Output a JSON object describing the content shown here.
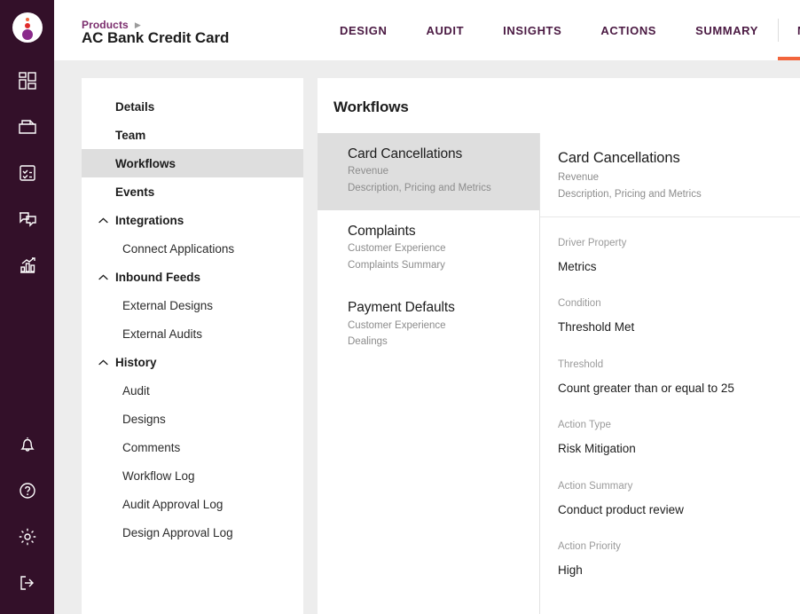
{
  "rail": {
    "avatar_name": "user-avatar",
    "icons": [
      {
        "name": "dashboard-icon"
      },
      {
        "name": "folder-icon"
      },
      {
        "name": "checklist-icon"
      },
      {
        "name": "comments-icon"
      },
      {
        "name": "analytics-icon"
      }
    ],
    "bottom_icons": [
      {
        "name": "bell-icon"
      },
      {
        "name": "help-icon"
      },
      {
        "name": "settings-icon"
      },
      {
        "name": "logout-icon"
      }
    ]
  },
  "header": {
    "breadcrumb": "Products",
    "breadcrumb_caret": "▶",
    "title": "AC Bank Credit Card",
    "tabs": [
      {
        "label": "DESIGN",
        "active": false,
        "divided": false
      },
      {
        "label": "AUDIT",
        "active": false,
        "divided": false
      },
      {
        "label": "INSIGHTS",
        "active": false,
        "divided": false
      },
      {
        "label": "ACTIONS",
        "active": false,
        "divided": false
      },
      {
        "label": "SUMMARY",
        "active": false,
        "divided": false
      },
      {
        "label": "MANA",
        "active": true,
        "divided": true
      }
    ]
  },
  "nav": {
    "items": [
      {
        "label": "Details",
        "level": "top",
        "caret": false,
        "selected": false
      },
      {
        "label": "Team",
        "level": "top",
        "caret": false,
        "selected": false
      },
      {
        "label": "Workflows",
        "level": "top",
        "caret": false,
        "selected": true
      },
      {
        "label": "Events",
        "level": "top",
        "caret": false,
        "selected": false
      },
      {
        "label": "Integrations",
        "level": "top",
        "caret": true,
        "selected": false
      },
      {
        "label": "Connect Applications",
        "level": "sub",
        "caret": false,
        "selected": false
      },
      {
        "label": "Inbound Feeds",
        "level": "top",
        "caret": true,
        "selected": false
      },
      {
        "label": "External Designs",
        "level": "sub",
        "caret": false,
        "selected": false
      },
      {
        "label": "External Audits",
        "level": "sub",
        "caret": false,
        "selected": false
      },
      {
        "label": "History",
        "level": "top",
        "caret": true,
        "selected": false
      },
      {
        "label": "Audit",
        "level": "sub",
        "caret": false,
        "selected": false
      },
      {
        "label": "Designs",
        "level": "sub",
        "caret": false,
        "selected": false
      },
      {
        "label": "Comments",
        "level": "sub",
        "caret": false,
        "selected": false
      },
      {
        "label": "Workflow Log",
        "level": "sub",
        "caret": false,
        "selected": false
      },
      {
        "label": "Audit Approval Log",
        "level": "sub",
        "caret": false,
        "selected": false
      },
      {
        "label": "Design Approval Log",
        "level": "sub",
        "caret": false,
        "selected": false
      }
    ]
  },
  "main": {
    "title": "Workflows",
    "workflows": [
      {
        "name": "Card Cancellations",
        "category": "Revenue",
        "subcategory": "Description, Pricing and Metrics",
        "selected": true
      },
      {
        "name": "Complaints",
        "category": "Customer Experience",
        "subcategory": "Complaints Summary",
        "selected": false
      },
      {
        "name": "Payment Defaults",
        "category": "Customer Experience",
        "subcategory": "Dealings",
        "selected": false
      }
    ],
    "detail": {
      "title": "Card Cancellations",
      "category": "Revenue",
      "subcategory": "Description, Pricing and Metrics",
      "fields": [
        {
          "label": "Driver Property",
          "value": "Metrics"
        },
        {
          "label": "Condition",
          "value": "Threshold Met"
        },
        {
          "label": "Threshold",
          "value": "Count greater than or equal to 25"
        },
        {
          "label": "Action Type",
          "value": "Risk Mitigation"
        },
        {
          "label": "Action Summary",
          "value": "Conduct product review"
        },
        {
          "label": "Action Priority",
          "value": "High"
        }
      ]
    }
  },
  "colors": {
    "rail_purple": "#331029",
    "accent_orange": "#f2653c",
    "tab_purple": "#4a1942",
    "breadcrumb_purple": "#7b2d6d",
    "selected_gray": "#dedede",
    "page_background": "#ededed"
  }
}
